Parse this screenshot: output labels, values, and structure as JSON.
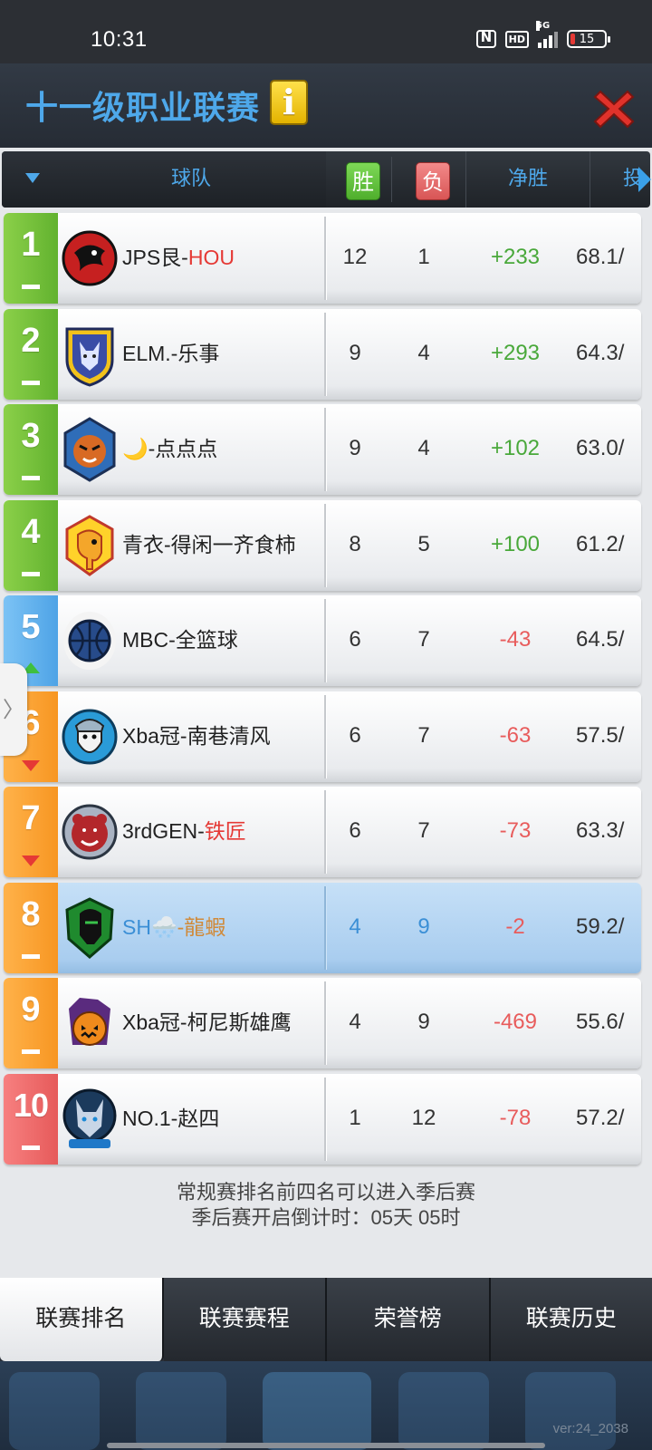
{
  "status_bar": {
    "time": "10:31",
    "battery": "15",
    "network": "5G",
    "hd": "HD"
  },
  "header": {
    "title": "十一级职业联赛",
    "info_icon": "i"
  },
  "table": {
    "sort_label": "",
    "columns": {
      "team": "球队",
      "win": "胜",
      "loss": "负",
      "net": "净胜",
      "shoot": "投"
    },
    "rows": [
      {
        "rank": "1",
        "trend": "same",
        "color": "green",
        "name_main": "JPS艮-",
        "name_accent": "HOU",
        "accent": "red",
        "win": "12",
        "loss": "1",
        "net": "+233",
        "pct": "68.1/",
        "logo": "dragon-logo-icon"
      },
      {
        "rank": "2",
        "trend": "same",
        "color": "green",
        "name_main": "ELM.-乐事",
        "name_accent": "",
        "accent": "",
        "win": "9",
        "loss": "4",
        "net": "+293",
        "pct": "64.3/",
        "logo": "wolf-shield-logo-icon"
      },
      {
        "rank": "3",
        "trend": "same",
        "color": "green",
        "name_main": "🌙-点点点",
        "name_accent": "",
        "accent": "",
        "win": "9",
        "loss": "4",
        "net": "+102",
        "pct": "63.0/",
        "logo": "tiger-logo-icon"
      },
      {
        "rank": "4",
        "trend": "same",
        "color": "green",
        "name_main": "青衣-得闲一齐食柿",
        "name_accent": "",
        "accent": "",
        "win": "8",
        "loss": "5",
        "net": "+100",
        "pct": "61.2/",
        "logo": "elephant-logo-icon"
      },
      {
        "rank": "5",
        "trend": "up",
        "color": "blue",
        "name_main": "MBC-全篮球",
        "name_accent": "",
        "accent": "",
        "win": "6",
        "loss": "7",
        "net": "-43",
        "pct": "64.5/",
        "logo": "basketball-logo-icon"
      },
      {
        "rank": "6",
        "trend": "down",
        "color": "orange",
        "name_main": "Xba冠-南巷清风",
        "name_accent": "",
        "accent": "",
        "win": "6",
        "loss": "7",
        "net": "-63",
        "pct": "57.5/",
        "logo": "viking-logo-icon"
      },
      {
        "rank": "7",
        "trend": "down",
        "color": "orange",
        "name_main": "3rdGEN-",
        "name_accent": "铁匠",
        "accent": "red",
        "win": "6",
        "loss": "7",
        "net": "-73",
        "pct": "63.3/",
        "logo": "bear-logo-icon"
      },
      {
        "rank": "8",
        "trend": "same",
        "color": "orange",
        "name_main": "SH🌨️",
        "name_accent": "-龍蝦",
        "accent": "orange",
        "win": "4",
        "loss": "9",
        "net": "-2",
        "pct": "59.2/",
        "logo": "knight-logo-icon",
        "highlight": true
      },
      {
        "rank": "9",
        "trend": "same",
        "color": "orange",
        "name_main": "Xba冠-柯尼斯雄鹰",
        "name_accent": "",
        "accent": "",
        "win": "4",
        "loss": "9",
        "net": "-469",
        "pct": "55.6/",
        "logo": "pumpkin-logo-icon"
      },
      {
        "rank": "10",
        "trend": "same",
        "color": "red",
        "name_main": "NO.1-赵四",
        "name_accent": "",
        "accent": "",
        "win": "1",
        "loss": "12",
        "net": "-78",
        "pct": "57.2/",
        "logo": "wolf-logo-icon"
      }
    ]
  },
  "side_tab": "〉",
  "notice": {
    "line1": "常规赛排名前四名可以进入季后赛",
    "line2": "季后赛开启倒计时：05天 05时"
  },
  "tabs": [
    {
      "label": "联赛排名",
      "active": true
    },
    {
      "label": "联赛赛程",
      "active": false
    },
    {
      "label": "荣誉榜",
      "active": false
    },
    {
      "label": "联赛历史",
      "active": false
    }
  ],
  "version": "ver:24_2038",
  "colors": {
    "accent": "#4ea8ea",
    "green": "#62b22f",
    "blue": "#4ea3e6",
    "orange": "#f79622",
    "red": "#e65a5a"
  }
}
